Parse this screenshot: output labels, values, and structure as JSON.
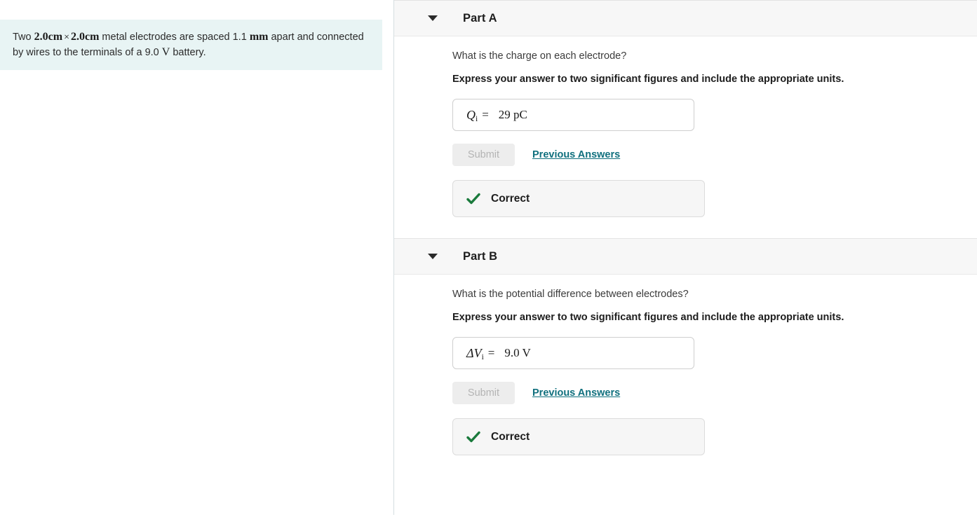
{
  "problem": {
    "segments": [
      {
        "type": "text",
        "value": "Two "
      },
      {
        "type": "math_bold",
        "value": "2.0cm"
      },
      {
        "type": "times",
        "value": "×"
      },
      {
        "type": "math_bold",
        "value": "2.0cm"
      },
      {
        "type": "text",
        "value": " metal electrodes are spaced 1.1 "
      },
      {
        "type": "math_bold",
        "value": "mm"
      },
      {
        "type": "text",
        "value": " apart and connected by wires to the terminals of a 9.0 "
      },
      {
        "type": "math_upright",
        "value": "V"
      },
      {
        "type": "text",
        "value": " battery."
      }
    ],
    "lead": "Two ",
    "dim1": "2.0cm",
    "times": "×",
    "dim2": "2.0cm",
    "mid": " metal electrodes are spaced 1.1 ",
    "unit_mm": "mm",
    "mid2": " apart and connected by wires to the terminals of a 9.0 ",
    "unit_v": "V",
    "tail": " battery.",
    "background_color": "#e8f4f4"
  },
  "parts": [
    {
      "title": "Part A",
      "question": "What is the charge on each electrode?",
      "instruction": "Express your answer to two significant figures and include the appropriate units.",
      "answer": {
        "variable": "Q",
        "subscript": "i",
        "equals": "=",
        "value": "29 pC"
      },
      "submit_label": "Submit",
      "submit_disabled": true,
      "previous_answers_label": "Previous Answers",
      "feedback": {
        "label": "Correct",
        "icon": "check-icon",
        "color": "#1a7a3c"
      }
    },
    {
      "title": "Part B",
      "question": "What is the potential difference between electrodes?",
      "instruction": "Express your answer to two significant figures and include the appropriate units.",
      "answer": {
        "variable": "ΔV",
        "subscript": "i",
        "equals": "=",
        "value": "9.0 V"
      },
      "submit_label": "Submit",
      "submit_disabled": true,
      "previous_answers_label": "Previous Answers",
      "feedback": {
        "label": "Correct",
        "icon": "check-icon",
        "color": "#1a7a3c"
      }
    }
  ],
  "colors": {
    "link": "#10707e",
    "correct_green": "#1a7a3c",
    "problem_bg": "#e8f4f4",
    "header_bg": "#f7f7f7",
    "feedback_bg": "#f6f6f6"
  }
}
